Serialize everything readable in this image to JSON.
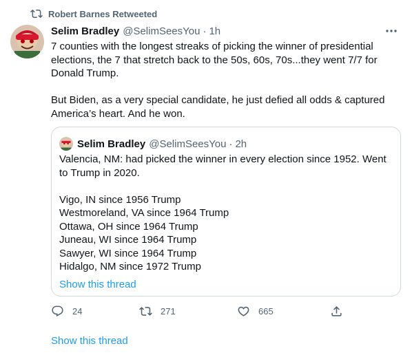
{
  "retweet_banner": {
    "icon": "retweet-icon",
    "label": "Robert Barnes Retweeted"
  },
  "tweet": {
    "author_name": "Selim Bradley",
    "author_handle": "@SelimSeesYou",
    "separator": "·",
    "time": "1h",
    "paragraphs": [
      "7 counties with the longest streaks of picking the winner of presidential elections, the 7 that stretch back to the 50s, 60s, 70s...they went 7/7 for Donald Trump.",
      "But Biden, as a very special candidate, he just defied all odds & captured America’s heart. And he won."
    ]
  },
  "quote": {
    "author_name": "Selim Bradley",
    "author_handle": "@SelimSeesYou",
    "separator": "·",
    "time": "2h",
    "intro": "Valencia, NM: had picked the winner in every election since 1952. Went to Trump in 2020.",
    "counties": [
      "Vigo, IN since 1956 Trump",
      "Westmoreland, VA since 1964 Trump",
      "Ottawa, OH since 1964 Trump",
      "Juneau, WI since 1964 Trump",
      "Sawyer, WI since 1964 Trump",
      "Hidalgo, NM since 1972 Trump"
    ],
    "show_thread": "Show this thread"
  },
  "actions": {
    "replies": "24",
    "retweets": "271",
    "likes": "665"
  },
  "show_thread": "Show this thread",
  "colors": {
    "accent": "#1d9bf0",
    "secondary_text": "#536471",
    "border": "#cfd9de"
  }
}
